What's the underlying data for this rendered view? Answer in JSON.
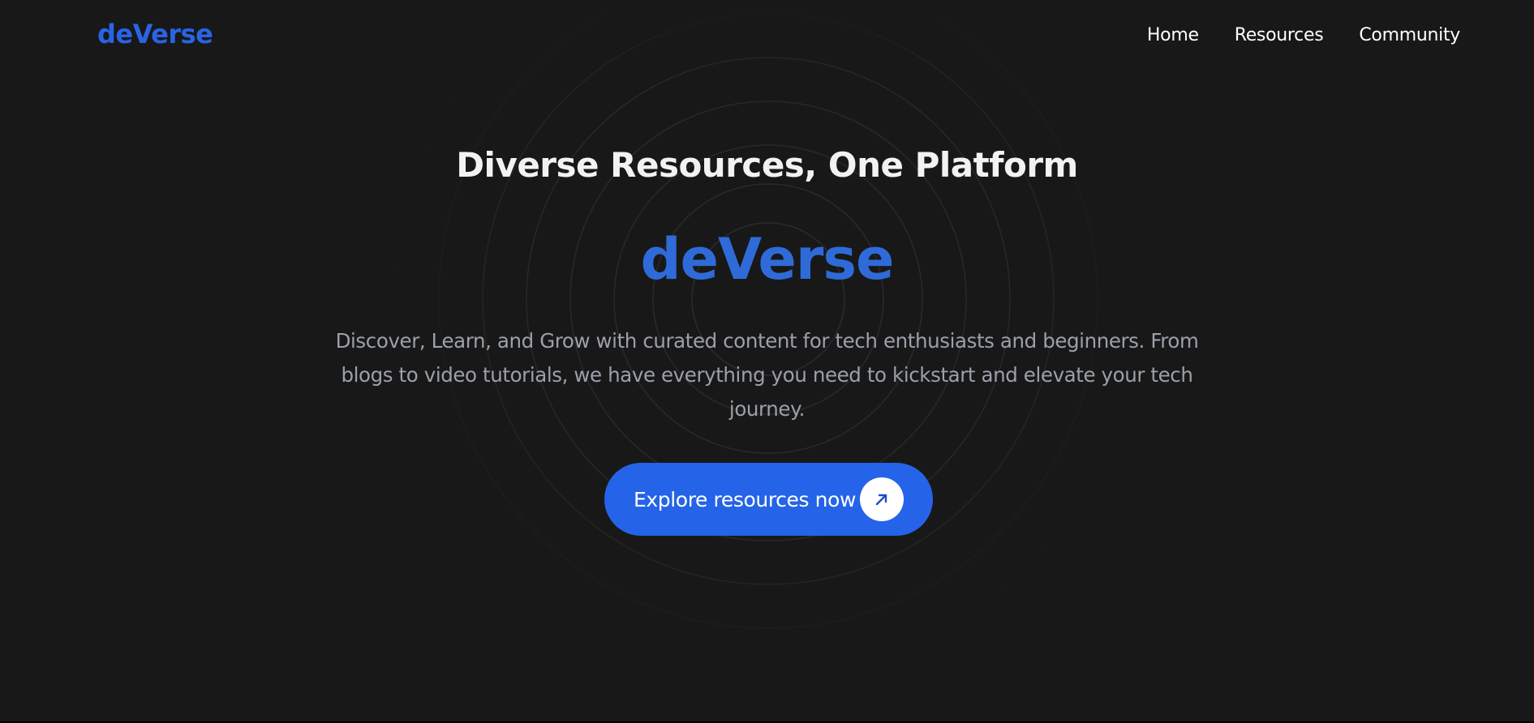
{
  "header": {
    "brand": "deVerse",
    "nav": [
      "Home",
      "Resources",
      "Community"
    ]
  },
  "hero": {
    "title": "Diverse Resources, One Platform",
    "brand": "deVerse",
    "description": "Discover, Learn, and Grow with curated content for tech enthusiasts and beginners. From blogs to video tutorials, we have everything you need to kickstart and elevate your tech journey.",
    "cta_label": "Explore resources now",
    "cta_icon": "arrow-up-right-icon"
  },
  "colors": {
    "background": "#181818",
    "accent": "#2563e8",
    "brand_text": "#2a63e6",
    "heading": "#f2f2f2",
    "body_text": "#9ba0a8"
  }
}
